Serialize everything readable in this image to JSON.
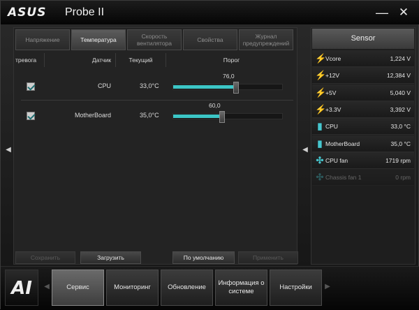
{
  "app": {
    "logo": "ASUS",
    "title": "Probe II"
  },
  "window_controls": {
    "minimize": "—",
    "close": "✕"
  },
  "tabs": [
    {
      "label": "Напряжение",
      "active": false
    },
    {
      "label": "Температура",
      "active": true
    },
    {
      "label": "Скорость вентилятора",
      "active": false
    },
    {
      "label": "Свойства",
      "active": false
    },
    {
      "label": "Журнал предупреждений",
      "active": false
    }
  ],
  "columns": {
    "alarm": "тревога",
    "sensor": "Датчик",
    "current": "Текущий",
    "threshold": "Порог"
  },
  "rows": [
    {
      "checked": true,
      "sensor": "CPU",
      "current": "33,0°C",
      "threshold": "76,0",
      "threshold_fraction": 0.57
    },
    {
      "checked": true,
      "sensor": "MotherBoard",
      "current": "35,0°C",
      "threshold": "60,0",
      "threshold_fraction": 0.44
    }
  ],
  "actions": {
    "save": "Сохранить",
    "load": "Загрузить",
    "default": "По умолчанию",
    "apply": "Применить"
  },
  "sensor_panel": {
    "title": "Sensor",
    "items": [
      {
        "icon": "lightning-icon",
        "label": "Vcore",
        "value": "1,224",
        "unit": "V",
        "dim": false
      },
      {
        "icon": "lightning-icon",
        "label": "+12V",
        "value": "12,384",
        "unit": "V",
        "dim": false
      },
      {
        "icon": "lightning-icon",
        "label": "+5V",
        "value": "5,040",
        "unit": "V",
        "dim": false
      },
      {
        "icon": "lightning-icon",
        "label": "+3.3V",
        "value": "3,392",
        "unit": "V",
        "dim": false
      },
      {
        "icon": "thermometer-icon",
        "label": "CPU",
        "value": "33,0",
        "unit": "°C",
        "dim": false
      },
      {
        "icon": "thermometer-icon",
        "label": "MotherBoard",
        "value": "35,0",
        "unit": "°C",
        "dim": false
      },
      {
        "icon": "fan-icon",
        "label": "CPU fan",
        "value": "1719",
        "unit": "rpm",
        "dim": false
      },
      {
        "icon": "fan-icon",
        "label": "Chassis fan 1",
        "value": "0",
        "unit": "rpm",
        "dim": true
      }
    ]
  },
  "bottom_nav": {
    "logo": "AI",
    "items": [
      {
        "label": "Сервис",
        "active": true
      },
      {
        "label": "Мониторинг",
        "active": false
      },
      {
        "label": "Обновление",
        "active": false
      },
      {
        "label": "Информация о системе",
        "active": false
      },
      {
        "label": "Настройки",
        "active": false
      }
    ]
  },
  "colors": {
    "accent": "#3cc6c6",
    "icon": "#46c7cf"
  }
}
